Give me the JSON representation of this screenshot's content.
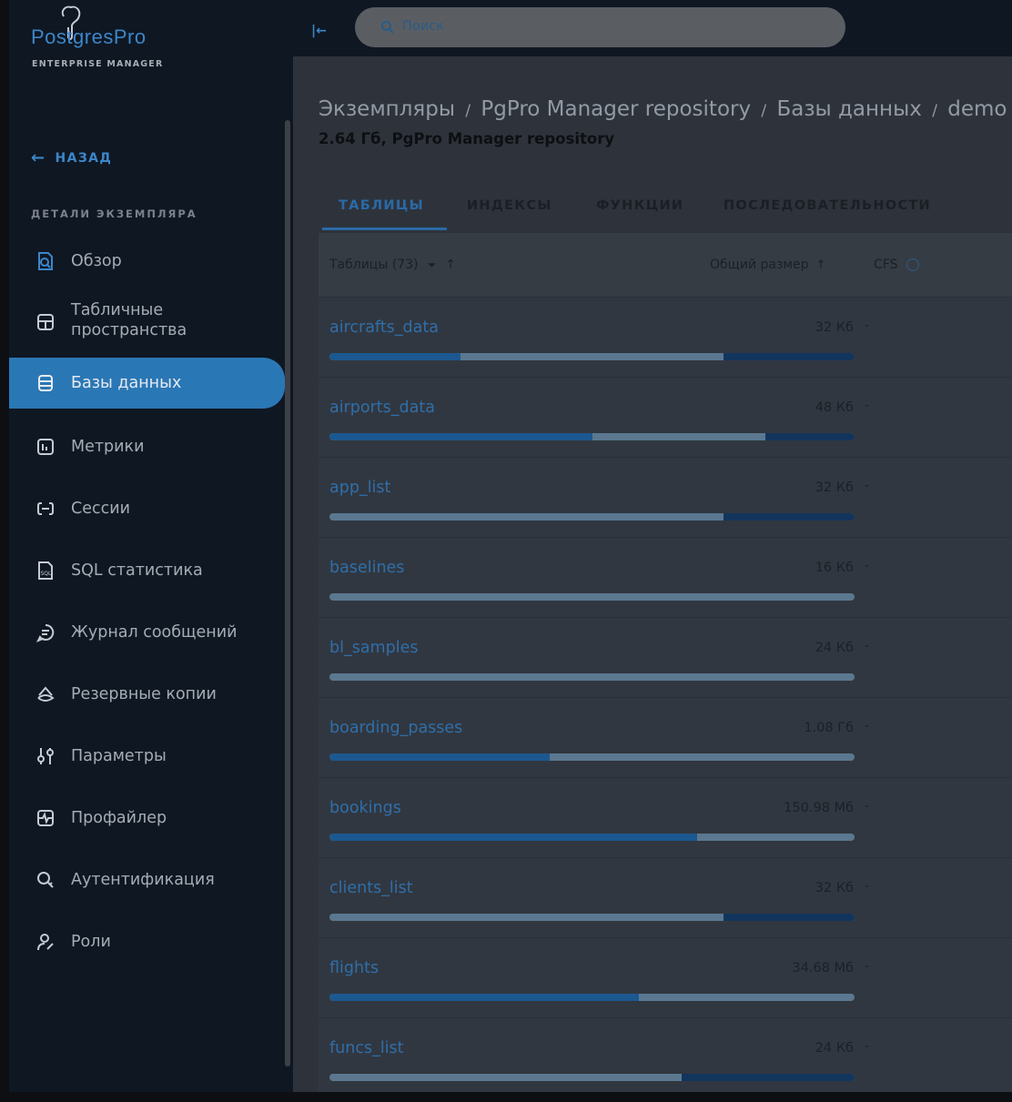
{
  "app": {
    "logo_text": "PostgresPro",
    "logo_subtitle": "ENTERPRISE MANAGER"
  },
  "sidebar": {
    "back_label": "НАЗАД",
    "section_title": "ДЕТАЛИ ЭКЗЕМПЛЯРА",
    "items": [
      {
        "label": "Обзор",
        "icon": "overview-icon"
      },
      {
        "label": "Табличные пространства",
        "icon": "tablespace-icon"
      },
      {
        "label": "Базы данных",
        "icon": "database-icon",
        "active": true
      },
      {
        "label": "Метрики",
        "icon": "metrics-icon"
      },
      {
        "label": "Сессии",
        "icon": "sessions-icon"
      },
      {
        "label": "SQL статистика",
        "icon": "sql-icon"
      },
      {
        "label": "Журнал сообщений",
        "icon": "message-log-icon"
      },
      {
        "label": "Резервные копии",
        "icon": "backup-icon"
      },
      {
        "label": "Параметры",
        "icon": "parameters-icon"
      },
      {
        "label": "Профайлер",
        "icon": "profiler-icon"
      },
      {
        "label": "Аутентификация",
        "icon": "authentication-icon"
      },
      {
        "label": "Роли",
        "icon": "roles-icon"
      }
    ]
  },
  "topbar": {
    "search_placeholder": "Поиск"
  },
  "breadcrumb": {
    "items": [
      "Экземпляры",
      "PgPro Manager repository",
      "Базы данных",
      "demo"
    ],
    "separator": "/"
  },
  "subtitle": "2.64 Гб, PgPro Manager repository",
  "tabs": [
    {
      "label": "ТАБЛИЦЫ",
      "active": true
    },
    {
      "label": "ИНДЕКСЫ"
    },
    {
      "label": "ФУНКЦИИ"
    },
    {
      "label": "ПОСЛЕДОВАТЕЛЬНОСТИ"
    }
  ],
  "table": {
    "headers": {
      "name": "Таблицы (73)",
      "size": "Общий размер",
      "cfs": "CFS"
    },
    "rows": [
      {
        "name": "aircrafts_data",
        "size": "32 Кб",
        "cfs": "-",
        "bar": {
          "a": 0.25,
          "b_start": 0.75,
          "b": 0.25
        }
      },
      {
        "name": "airports_data",
        "size": "48 Кб",
        "cfs": "-",
        "bar": {
          "a": 0.5,
          "b_start": 0.83,
          "b": 0.17
        }
      },
      {
        "name": "app_list",
        "size": "32 Кб",
        "cfs": "-",
        "bar": {
          "a": 0,
          "b_start": 0.75,
          "b": 0.25
        }
      },
      {
        "name": "baselines",
        "size": "16 Кб",
        "cfs": "-",
        "bar": {
          "a": 0,
          "b_start": 0,
          "b": 0
        }
      },
      {
        "name": "bl_samples",
        "size": "24 Кб",
        "cfs": "-",
        "bar": {
          "a": 0,
          "b_start": 0,
          "b": 0
        }
      },
      {
        "name": "boarding_passes",
        "size": "1.08 Гб",
        "cfs": "-",
        "bar": {
          "a": 0.42,
          "b_start": 0,
          "b": 0
        }
      },
      {
        "name": "bookings",
        "size": "150.98 Мб",
        "cfs": "-",
        "bar": {
          "a": 0.7,
          "b_start": 0,
          "b": 0
        }
      },
      {
        "name": "clients_list",
        "size": "32 Кб",
        "cfs": "-",
        "bar": {
          "a": 0,
          "b_start": 0.75,
          "b": 0.25
        }
      },
      {
        "name": "flights",
        "size": "34.68 Мб",
        "cfs": "-",
        "bar": {
          "a": 0.59,
          "b_start": 0,
          "b": 0
        }
      },
      {
        "name": "funcs_list",
        "size": "24 Кб",
        "cfs": "-",
        "bar": {
          "a": 0,
          "b_start": 0.67,
          "b": 0.33
        }
      }
    ]
  },
  "colors": {
    "accent": "#2a77b5",
    "link": "#2f6ea9",
    "sidebar_bg": "#0f1722",
    "main_bg": "#2e333b"
  }
}
